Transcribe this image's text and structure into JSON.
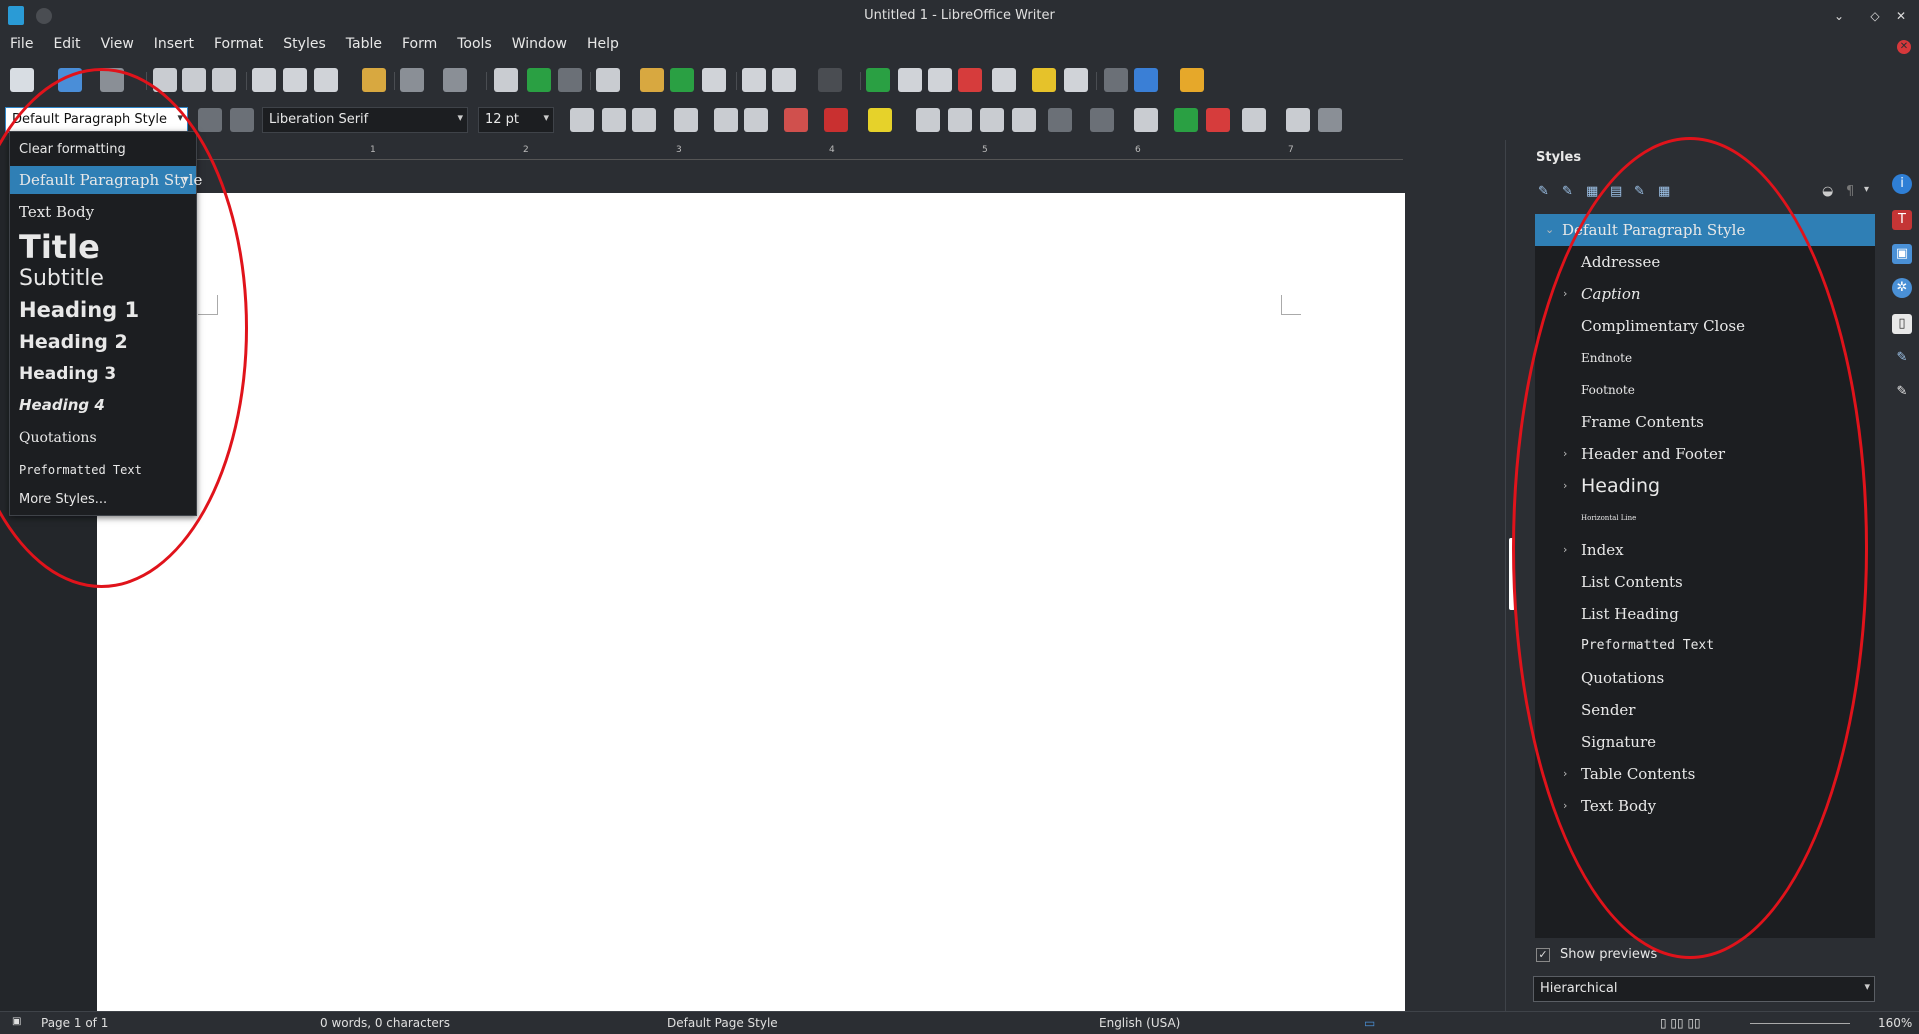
{
  "window": {
    "title": "Untitled 1 - LibreOffice Writer",
    "controls": [
      "⌄",
      "◇",
      "✕"
    ]
  },
  "menu": [
    "File",
    "Edit",
    "View",
    "Insert",
    "Format",
    "Styles",
    "Table",
    "Form",
    "Tools",
    "Window",
    "Help"
  ],
  "formatting": {
    "paragraph_style": "Default Paragraph Style",
    "font_name": "Liberation Serif",
    "font_size": "12 pt"
  },
  "ruler_ticks": [
    "1",
    "2",
    "3",
    "4",
    "5",
    "6",
    "7"
  ],
  "style_dropdown": {
    "items": [
      {
        "label": "Clear formatting",
        "kind": "plain"
      },
      {
        "label": "Default Paragraph Style",
        "kind": "selected"
      },
      {
        "label": "Text Body",
        "kind": "serif"
      },
      {
        "label": "Title",
        "kind": "title"
      },
      {
        "label": "Subtitle",
        "kind": "subtitle"
      },
      {
        "label": "Heading 1",
        "kind": "h1"
      },
      {
        "label": "Heading 2",
        "kind": "h2"
      },
      {
        "label": "Heading 3",
        "kind": "h3"
      },
      {
        "label": "Heading 4",
        "kind": "h4"
      },
      {
        "label": "Quotations",
        "kind": "serif"
      },
      {
        "label": "Preformatted Text",
        "kind": "mono"
      },
      {
        "label": "More Styles...",
        "kind": "plain"
      }
    ]
  },
  "styles_panel": {
    "title": "Styles",
    "items": [
      {
        "label": "Default Paragraph Style",
        "expand": "⌄",
        "selected": true
      },
      {
        "label": "Addressee",
        "expand": ""
      },
      {
        "label": "Caption",
        "expand": "›",
        "italic": true
      },
      {
        "label": "Complimentary Close",
        "expand": ""
      },
      {
        "label": "Endnote",
        "expand": "",
        "small": true
      },
      {
        "label": "Footnote",
        "expand": "",
        "small": true
      },
      {
        "label": "Frame Contents",
        "expand": ""
      },
      {
        "label": "Header and Footer",
        "expand": "›"
      },
      {
        "label": "Heading",
        "expand": "›",
        "heading": true
      },
      {
        "label": "Horizontal Line",
        "expand": "",
        "tiny": true
      },
      {
        "label": "Index",
        "expand": "›"
      },
      {
        "label": "List Contents",
        "expand": ""
      },
      {
        "label": "List Heading",
        "expand": ""
      },
      {
        "label": "Preformatted Text",
        "expand": "",
        "mono": true
      },
      {
        "label": "Quotations",
        "expand": ""
      },
      {
        "label": "Sender",
        "expand": ""
      },
      {
        "label": "Signature",
        "expand": ""
      },
      {
        "label": "Table Contents",
        "expand": "›"
      },
      {
        "label": "Text Body",
        "expand": "›"
      }
    ],
    "show_previews_label": "Show previews",
    "show_previews_checked": "✓",
    "filter": "Hierarchical"
  },
  "status": {
    "page": "Page 1 of 1",
    "words": "0 words, 0 characters",
    "page_style": "Default Page Style",
    "language": "English (USA)",
    "zoom": "160%"
  },
  "colors": {
    "accent": "#2f7fb5",
    "annotation": "#e0131b"
  }
}
